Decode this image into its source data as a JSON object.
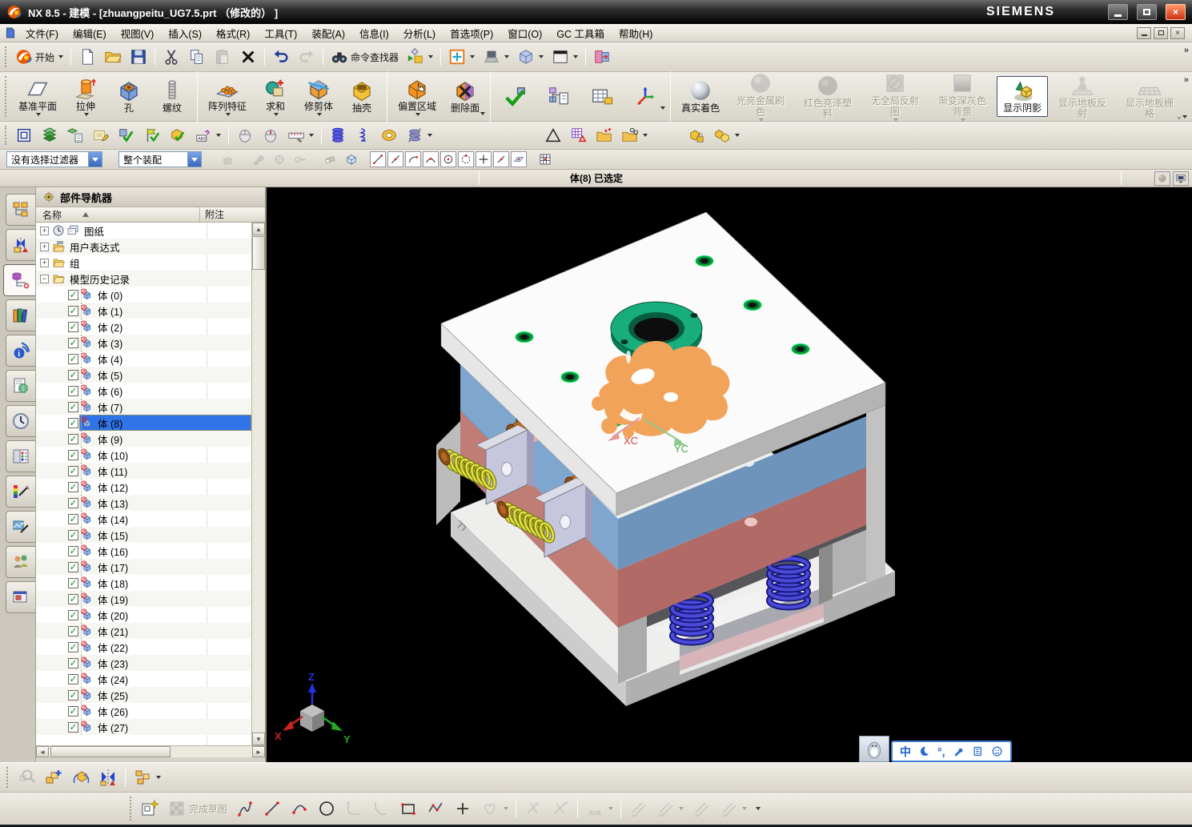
{
  "theme": {
    "accent_blue": "#2f74e8",
    "selection_orange": "#f2a35a",
    "plate_blue": "#7fa6cf",
    "plate_red": "#bc7370",
    "ring_green": "#17ad7d",
    "spring_yellow": "#e2e246",
    "spring_blue": "#4a4ad8",
    "viewport_background": "#000000",
    "chrome_gray": "#d9d5ca"
  },
  "window": {
    "title": "NX 8.5 - 建模 - [zhuangpeitu_UG7.5.prt （修改的） ]",
    "brand": "SIEMENS",
    "controls": [
      "minimize",
      "maximize",
      "close"
    ],
    "document_controls": [
      "minimize",
      "restore",
      "close"
    ]
  },
  "menu": {
    "items": [
      "文件(F)",
      "编辑(E)",
      "视图(V)",
      "插入(S)",
      "格式(R)",
      "工具(T)",
      "装配(A)",
      "信息(I)",
      "分析(L)",
      "首选项(P)",
      "窗口(O)",
      "GC 工具箱",
      "帮助(H)"
    ]
  },
  "toolbars": {
    "standard": {
      "items": [
        {
          "name": "start-menu-button",
          "icon": "nx",
          "label": "开始",
          "dd": true
        },
        {
          "sep": true
        },
        {
          "name": "new-file-button",
          "icon": "new"
        },
        {
          "name": "open-file-button",
          "icon": "open"
        },
        {
          "name": "save-button",
          "icon": "save"
        },
        {
          "sep": true
        },
        {
          "name": "cut-button",
          "icon": "cut"
        },
        {
          "name": "copy-button",
          "icon": "copy"
        },
        {
          "name": "paste-button",
          "icon": "paste",
          "disabled": true
        },
        {
          "name": "delete-button",
          "icon": "delx"
        },
        {
          "sep": true
        },
        {
          "name": "undo-button",
          "icon": "undo"
        },
        {
          "name": "redo-button",
          "icon": "redo",
          "disabled": true
        },
        {
          "sep": true
        },
        {
          "name": "command-finder-button",
          "icon": "binoc",
          "label": "命令查找器"
        },
        {
          "name": "launch-dialog-button",
          "icon": "launch",
          "dd": true
        },
        {
          "sep": true
        },
        {
          "name": "fit-view-button",
          "icon": "fit",
          "dd": true
        },
        {
          "name": "display-mode-button",
          "icon": "laptop",
          "dd": true
        },
        {
          "name": "view-orient-button",
          "icon": "cube",
          "dd": true
        },
        {
          "name": "window-style-button",
          "icon": "window",
          "dd": true
        },
        {
          "sep": true
        },
        {
          "name": "new-part-window-button",
          "icon": "door"
        }
      ]
    },
    "features": {
      "items": [
        {
          "name": "datum-plane-button",
          "icon": "datum",
          "label": "基准平面",
          "dd": true
        },
        {
          "name": "extrude-button",
          "icon": "extrude",
          "label": "拉伸",
          "dd": true
        },
        {
          "name": "hole-button",
          "icon": "hole",
          "label": "孔"
        },
        {
          "name": "thread-button",
          "icon": "thread",
          "label": "螺纹"
        },
        {
          "sep": true
        },
        {
          "name": "pattern-feature-button",
          "icon": "pattern",
          "label": "阵列特征",
          "dd": true
        },
        {
          "name": "unite-button",
          "icon": "unite",
          "label": "求和",
          "dd": true
        },
        {
          "name": "trim-body-button",
          "icon": "trim",
          "label": "修剪体",
          "dd": true
        },
        {
          "name": "shell-button",
          "icon": "shell",
          "label": "抽壳"
        },
        {
          "sep": true
        },
        {
          "name": "offset-region-button",
          "icon": "offset",
          "label": "偏置区域",
          "dd": true
        },
        {
          "name": "delete-face-button",
          "icon": "delface",
          "label": "删除面",
          "dd2": true
        },
        {
          "sep": true
        },
        {
          "name": "assembly-constraints-button",
          "icon": "asmcheck"
        },
        {
          "name": "component-tree-button",
          "icon": "comptree"
        },
        {
          "name": "component-table-button",
          "icon": "comptable"
        },
        {
          "name": "explode-view-button",
          "icon": "explode",
          "dd2": true
        },
        {
          "sep": true
        },
        {
          "name": "true-shading-button",
          "icon": "sphshiny",
          "label": "真实着色"
        },
        {
          "name": "shiny-metal-button",
          "icon": "sphmetal",
          "label": "光亮金属刷色",
          "dd": true,
          "disabled": true
        },
        {
          "name": "red-plastic-button",
          "icon": "sphred",
          "label": "红色亮泽塑料",
          "disabled": true
        },
        {
          "name": "no-reflection-button",
          "icon": "norefl",
          "label": "无全局反射图",
          "dd": true,
          "disabled": true
        },
        {
          "name": "gradient-bg-button",
          "icon": "gradbg",
          "label": "渐变深灰色背景",
          "dd": true,
          "disabled": true
        },
        {
          "name": "show-shadow-button",
          "icon": "shadow",
          "label": "显示阴影",
          "active": true
        },
        {
          "name": "floor-reflection-button",
          "icon": "floorrefl",
          "label": "显示地板反射",
          "disabled": true
        },
        {
          "name": "floor-grid-button",
          "icon": "floorgrid",
          "label": "显示地板栅格",
          "disabled": true,
          "dd2": true
        }
      ]
    },
    "utilities": {
      "items": [
        {
          "name": "snapshot-button",
          "icon": "snapshot"
        },
        {
          "name": "layer-settings-button",
          "icon": "layerstack"
        },
        {
          "name": "layer-category-button",
          "icon": "layerlist"
        },
        {
          "name": "annotation-note-button",
          "icon": "memo"
        },
        {
          "name": "examine-geometry-button",
          "icon": "checkpart"
        },
        {
          "name": "check-mate-button",
          "icon": "checkflag"
        },
        {
          "name": "interference-check-button",
          "icon": "checkbox"
        },
        {
          "name": "assembly-label-button",
          "icon": "abc",
          "dd": true
        },
        {
          "sep": true
        },
        {
          "name": "mouse-pan-button",
          "icon": "mousea"
        },
        {
          "name": "mouse-rotate-button",
          "icon": "mouseb"
        },
        {
          "name": "measure-button",
          "icon": "measure",
          "dd": true
        },
        {
          "sep": true
        },
        {
          "name": "spring-tool-button",
          "icon": "springcoil"
        },
        {
          "name": "wire-spring-button",
          "icon": "springwire"
        },
        {
          "name": "washer-tool-button",
          "icon": "washer"
        },
        {
          "name": "spring-suppress-button",
          "icon": "springcross",
          "dd": true
        },
        {
          "gap": 130
        },
        {
          "name": "draft-analysis-button",
          "icon": "triangle"
        },
        {
          "name": "datum-table-button",
          "icon": "tabletri"
        },
        {
          "name": "point-set-folder-button",
          "icon": "folderpts"
        },
        {
          "name": "circle-set-folder-button",
          "icon": "foldercirc",
          "dd": true
        },
        {
          "gap": 40
        },
        {
          "name": "sealed-box-button",
          "icon": "boxlocka"
        },
        {
          "name": "box-group-button",
          "icon": "boxlockb",
          "dd": true
        }
      ]
    },
    "selection": {
      "filter_label": "没有选择过滤器",
      "scope_label": "整个装配",
      "tools": [
        {
          "name": "grab-tool-button",
          "icon": "hand",
          "disabled": true
        },
        {
          "gap": 12
        },
        {
          "name": "wrench-tool-button",
          "icon": "wrench",
          "disabled": true
        },
        {
          "name": "snap-target-button",
          "icon": "target",
          "disabled": true
        },
        {
          "name": "key-tool-button",
          "icon": "key",
          "disabled": true
        },
        {
          "gap": 12
        },
        {
          "name": "eraser-tool-button",
          "icon": "eraser",
          "disabled": true
        },
        {
          "name": "show-box-button",
          "icon": "boxblue"
        }
      ],
      "snaps": [
        {
          "name": "snap-endpoint-button",
          "icon": "snapline2"
        },
        {
          "name": "snap-midpoint-button",
          "icon": "snapline"
        },
        {
          "name": "snap-arc-end-button",
          "icon": "snaparc"
        },
        {
          "name": "snap-pole-button",
          "icon": "snappeak"
        },
        {
          "name": "snap-circle-center-button",
          "icon": "snapcc"
        },
        {
          "name": "snap-quadrant-button",
          "icon": "snapcd"
        },
        {
          "name": "snap-intersection-button",
          "icon": "snapplus"
        },
        {
          "name": "snap-point-on-curve-button",
          "icon": "snapslash"
        },
        {
          "name": "snap-point-on-face-button",
          "icon": "snapface"
        }
      ],
      "end_icon": "gridend"
    }
  },
  "prompt": {
    "text": "体(8) 已选定"
  },
  "resource_bar": {
    "tabs": [
      {
        "name": "tab-assembly-navigator",
        "icon": "rbassy"
      },
      {
        "name": "tab-constraint-navigator",
        "icon": "rbcon"
      },
      {
        "name": "tab-part-navigator",
        "icon": "rbpart",
        "selected": true
      },
      {
        "name": "tab-reuse-library",
        "icon": "rblib"
      },
      {
        "name": "tab-hd3d-tools",
        "icon": "rbinfo"
      },
      {
        "name": "tab-web-browser",
        "icon": "rbweb"
      },
      {
        "name": "tab-history",
        "icon": "rbhist"
      },
      {
        "name": "tab-system-materials",
        "icon": "rbpalette"
      },
      {
        "name": "tab-color-tool",
        "icon": "rbcolor"
      },
      {
        "name": "tab-visualization",
        "icon": "rbviz"
      },
      {
        "name": "tab-roles",
        "icon": "rbroles"
      },
      {
        "name": "tab-windows",
        "icon": "rbdialog"
      }
    ]
  },
  "navigator": {
    "title": "部件导航器",
    "columns": [
      "名称",
      "附注"
    ],
    "groups": [
      {
        "label": "图纸",
        "icons": [
          "clock",
          "drawing"
        ],
        "state": "collapsed"
      },
      {
        "label": "用户表达式",
        "icons": [
          "folderexpr"
        ],
        "state": "collapsed"
      },
      {
        "label": "组",
        "icons": [
          "folder"
        ],
        "state": "collapsed"
      },
      {
        "label": "模型历史记录",
        "icons": [
          "folderopen"
        ],
        "state": "expanded"
      }
    ],
    "bodies": [
      "体 (0)",
      "体 (1)",
      "体 (2)",
      "体 (3)",
      "体 (4)",
      "体 (5)",
      "体 (6)",
      "体 (7)",
      "体 (8)",
      "体 (9)",
      "体 (10)",
      "体 (11)",
      "体 (12)",
      "体 (13)",
      "体 (14)",
      "体 (15)",
      "体 (16)",
      "体 (17)",
      "体 (18)",
      "体 (19)",
      "体 (20)",
      "体 (21)",
      "体 (22)",
      "体 (23)",
      "体 (24)",
      "体 (25)",
      "体 (26)",
      "体 (27)"
    ],
    "all_checked": true,
    "selected_index": 8,
    "selected_label": "体 (8)"
  },
  "viewport": {
    "wcs": {
      "x": "XC",
      "y": "YC"
    },
    "triad": {
      "x": "X",
      "y": "Y",
      "z": "Z"
    }
  },
  "ime": {
    "mode": "中",
    "punct": "°,",
    "icons": [
      "moon",
      "punct",
      "wrench",
      "keyboard",
      "smiley"
    ]
  },
  "assembly_bar": {
    "items": [
      {
        "name": "find-component-button",
        "icon": "findcomp",
        "disabled": true
      },
      {
        "name": "add-component-button",
        "icon": "addcomp"
      },
      {
        "name": "move-component-button",
        "icon": "movecomp"
      },
      {
        "name": "mirror-assembly-button",
        "icon": "mirrorasm"
      },
      {
        "sep": true
      },
      {
        "name": "pattern-component-button",
        "icon": "patterncomp",
        "dd": true
      }
    ]
  },
  "sketch_bar": {
    "items": [
      {
        "name": "sketch-in-task-button",
        "icon": "sketchstar"
      },
      {
        "name": "finish-sketch-button",
        "icon": "sketchshaded",
        "label": "完成草图",
        "disabled": true
      },
      {
        "name": "profile-button",
        "icon": "skprofile"
      },
      {
        "name": "line-button",
        "icon": "skline"
      },
      {
        "name": "arc-button",
        "icon": "skarc"
      },
      {
        "name": "circle-button",
        "icon": "skcircle"
      },
      {
        "name": "fillet-button",
        "icon": "skfillet",
        "disabled": true
      },
      {
        "name": "chamfer-button",
        "icon": "skchamfer",
        "disabled": true
      },
      {
        "name": "rectangle-button",
        "icon": "skrect"
      },
      {
        "name": "polyline-button",
        "icon": "skpoly"
      },
      {
        "name": "point-button",
        "icon": "skplus"
      },
      {
        "name": "pattern-curve-button",
        "icon": "skheart",
        "disabled": true,
        "dd": true
      },
      {
        "sep": true
      },
      {
        "name": "quick-trim-button",
        "icon": "sktrim",
        "disabled": true
      },
      {
        "name": "quick-extend-button",
        "icon": "skext",
        "disabled": true
      },
      {
        "sep": true
      },
      {
        "name": "rapid-dimension-button",
        "icon": "skdim",
        "disabled": true,
        "dd": true
      },
      {
        "sep": true
      },
      {
        "name": "geometric-constraint-button",
        "icon": "skcon",
        "disabled": true
      },
      {
        "name": "auto-constraint-button",
        "icon": "skcon",
        "disabled": true,
        "dd": true
      },
      {
        "name": "show-constraint-button",
        "icon": "skcon",
        "disabled": true
      },
      {
        "name": "constraint-settings-button",
        "icon": "skcon",
        "disabled": true,
        "dd": true
      }
    ]
  }
}
